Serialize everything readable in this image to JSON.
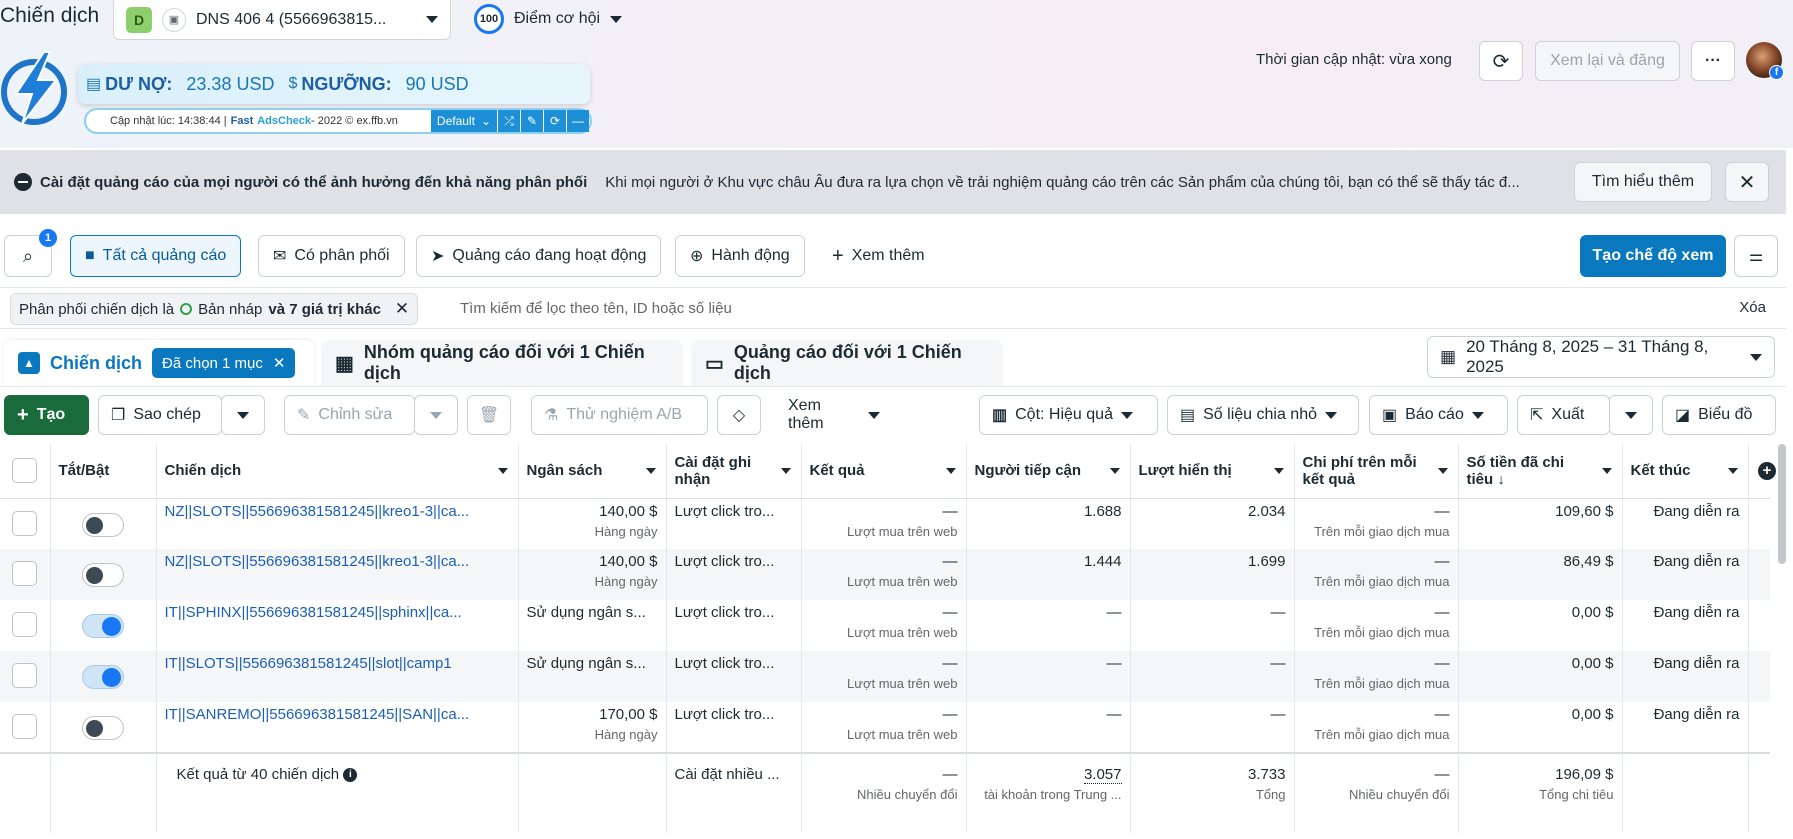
{
  "header": {
    "page_title": "Chiến dịch",
    "account_badge": "D",
    "account_name": "DNS 406 4 (5566963815...",
    "opportunity_score": "100",
    "opportunity_label": "Điểm cơ hội",
    "update_time": "Thời gian cập nhật: vừa xong",
    "review_publish": "Xem lại và đăng",
    "more": "···",
    "fb_badge": "f"
  },
  "fastads": {
    "debt_label": "DƯ NỢ:",
    "debt_value": "23.38 USD",
    "threshold_label": "NGƯỠNG:",
    "threshold_value": "90 USD",
    "status_prefix": "Cập nhật lúc: 14:38:44 | ",
    "brand1": "Fast",
    "brand2": "AdsCheck",
    "status_suffix": " - 2022 © ex.ffb.vn",
    "default_label": "Default"
  },
  "banner": {
    "title": "Cài đặt quảng cáo của mọi người có thể ảnh hưởng đến khả năng phân phối",
    "text": "Khi mọi người ở Khu vực châu Âu đưa ra lựa chọn về trải nghiệm quảng cáo trên các Sản phẩm của chúng tôi, bạn có thể sẽ thấy tác đ...",
    "learn_more": "Tìm hiểu thêm"
  },
  "filters": {
    "search_count": "1",
    "chips": [
      "Tất cả quảng cáo",
      "Có phân phối",
      "Quảng cáo đang hoạt động",
      "Hành động",
      "Xem thêm"
    ],
    "create_view": "Tạo chế độ xem",
    "active_filter_prefix": "Phân phối chiến dịch là",
    "active_filter_value": "Bản nháp",
    "active_filter_suffix": "và 7 giá trị khác",
    "search_placeholder": "Tìm kiếm để lọc theo tên, ID hoặc số liệu",
    "clear": "Xóa"
  },
  "tabs": {
    "campaign": "Chiến dịch",
    "selected": "Đã chọn 1 mục",
    "adsets": "Nhóm quảng cáo đối với 1 Chiến dịch",
    "ads": "Quảng cáo đối với 1 Chiến dịch",
    "date_range": "20 Tháng 8, 2025 – 31 Tháng 8, 2025"
  },
  "toolbar": {
    "create": "Tạo",
    "duplicate": "Sao chép",
    "edit": "Chỉnh sửa",
    "ab_test": "Thử nghiệm A/B",
    "more": "Xem thêm",
    "columns": "Cột: Hiệu quả",
    "breakdown": "Số liệu chia nhỏ",
    "reports": "Báo cáo",
    "export": "Xuất",
    "charts": "Biểu đồ"
  },
  "columns": [
    "Tắt/Bật",
    "Chiến dịch",
    "Ngân sách",
    "Cài đặt ghi nhận",
    "Kết quả",
    "Người tiếp cận",
    "Lượt hiển thị",
    "Chi phí trên mỗi kết quả",
    "Số tiền đã chi tiêu ↓",
    "Kết thúc"
  ],
  "rows": [
    {
      "on": false,
      "name": "NZ||SLOTS||556696381581245||kreo1-3||ca...",
      "budget": "140,00 $",
      "budget_sub": "Hàng ngày",
      "attribution": "Lượt click tro...",
      "result": "—",
      "result_sub": "Lượt mua trên web",
      "reach": "1.688",
      "impressions": "2.034",
      "cpr": "—",
      "cpr_sub": "Trên mỗi giao dịch mua",
      "spent": "109,60 $",
      "end": "Đang diễn ra"
    },
    {
      "on": false,
      "name": "NZ||SLOTS||556696381581245||kreo1-3||ca...",
      "budget": "140,00 $",
      "budget_sub": "Hàng ngày",
      "attribution": "Lượt click tro...",
      "result": "—",
      "result_sub": "Lượt mua trên web",
      "reach": "1.444",
      "impressions": "1.699",
      "cpr": "—",
      "cpr_sub": "Trên mỗi giao dịch mua",
      "spent": "86,49 $",
      "end": "Đang diễn ra"
    },
    {
      "on": true,
      "name": "IT||SPHINX||556696381581245||sphinx||ca...",
      "budget": "Sử dụng ngân s...",
      "budget_sub": "",
      "attribution": "Lượt click tro...",
      "result": "—",
      "result_sub": "Lượt mua trên web",
      "reach": "—",
      "impressions": "—",
      "cpr": "—",
      "cpr_sub": "Trên mỗi giao dịch mua",
      "spent": "0,00 $",
      "end": "Đang diễn ra"
    },
    {
      "on": true,
      "name": "IT||SLOTS||556696381581245||slot||camp1",
      "budget": "Sử dụng ngân s...",
      "budget_sub": "",
      "attribution": "Lượt click tro...",
      "result": "—",
      "result_sub": "Lượt mua trên web",
      "reach": "—",
      "impressions": "—",
      "cpr": "—",
      "cpr_sub": "Trên mỗi giao dịch mua",
      "spent": "0,00 $",
      "end": "Đang diễn ra"
    },
    {
      "on": false,
      "name": "IT||SANREMO||556696381581245||SAN||ca...",
      "budget": "170,00 $",
      "budget_sub": "Hàng ngày",
      "attribution": "Lượt click tro...",
      "result": "—",
      "result_sub": "Lượt mua trên web",
      "reach": "—",
      "impressions": "—",
      "cpr": "—",
      "cpr_sub": "Trên mỗi giao dịch mua",
      "spent": "0,00 $",
      "end": "Đang diễn ra"
    }
  ],
  "totals": {
    "label": "Kết quả từ 40 chiến dịch",
    "info": "i",
    "attribution": "Cài đặt nhiều ...",
    "result": "—",
    "result_sub": "Nhiều chuyển đổi",
    "reach": "3.057",
    "reach_sub": "tài khoản trong Trung ...",
    "impressions": "3.733",
    "impressions_sub": "Tổng",
    "cpr": "—",
    "cpr_sub": "Nhiều chuyển đổi",
    "spent": "196,09 $",
    "spent_sub": "Tổng chi tiêu"
  }
}
